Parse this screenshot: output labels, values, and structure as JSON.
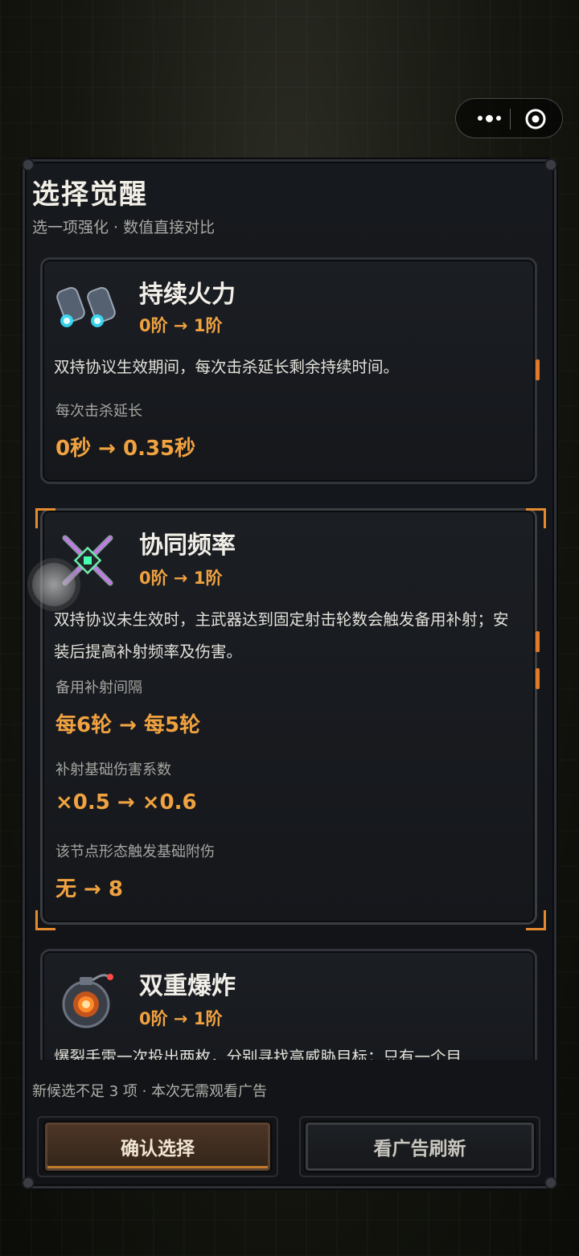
{
  "header": {
    "title": "选择觉醒",
    "subtitle": "选一项强化 · 数值直接对比"
  },
  "cards": [
    {
      "name": "持续火力",
      "level": "0阶 → 1阶",
      "icon": "twin-thrusters-icon",
      "description": "双持协议生效期间，每次击杀延长剩余持续时间。",
      "stats": [
        {
          "label": "每次击杀延长",
          "value": "0秒 → 0.35秒"
        }
      ]
    },
    {
      "name": "协同频率",
      "level": "0阶 → 1阶",
      "icon": "crossed-blades-core-icon",
      "description": "双持协议未生效时，主武器达到固定射击轮数会触发备用补射；安装后提高补射频率及伤害。",
      "selected": true,
      "stats": [
        {
          "label": "备用补射间隔",
          "value": "每6轮 → 每5轮"
        },
        {
          "label": "补射基础伤害系数",
          "value": "×0.5 → ×0.6"
        },
        {
          "label": "该节点形态触发基础附伤",
          "value": "无 → 8"
        }
      ]
    },
    {
      "name": "双重爆炸",
      "level": "0阶 → 1阶",
      "icon": "grenade-icon",
      "description": "爆裂手雷一次投出两枚，分别寻找高威胁目标；只有一个目"
    }
  ],
  "footer": {
    "note": "新候选不足 3 项 · 本次无需观看广告",
    "confirm_label": "确认选择",
    "refresh_label": "看广告刷新"
  },
  "colors": {
    "accent": "#f0a241",
    "selected_bracket": "#e68a2e",
    "panel_bg": "#15171b"
  }
}
